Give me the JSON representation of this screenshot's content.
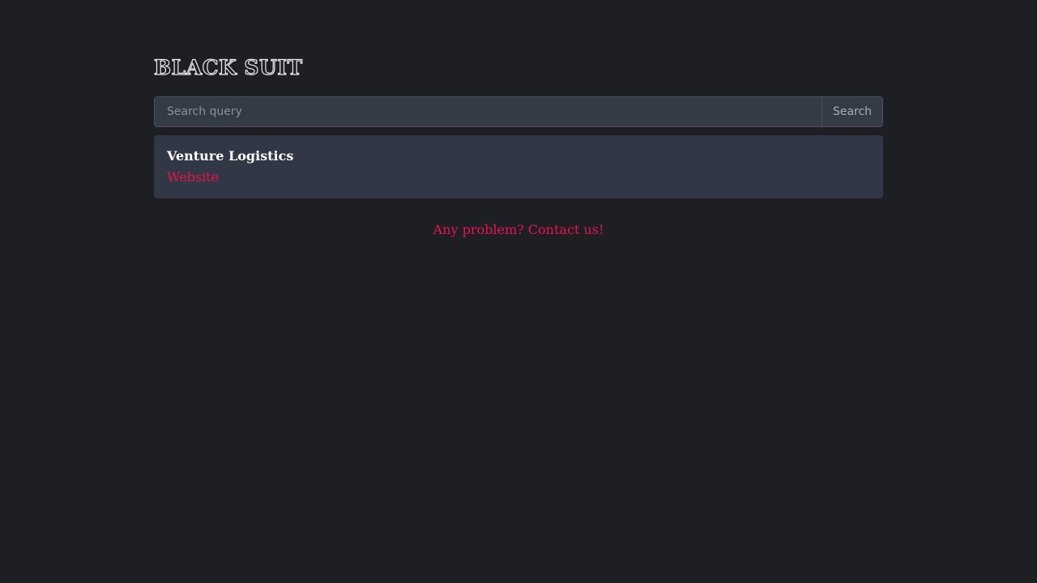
{
  "header": {
    "logo_text": "BLACK SUIT"
  },
  "search": {
    "placeholder": "Search query",
    "value": "",
    "button_label": "Search"
  },
  "results": [
    {
      "title": "Venture Logistics",
      "link_label": "Website"
    }
  ],
  "footer": {
    "contact_label": "Any problem? Contact us!"
  },
  "colors": {
    "background": "#1e1f23",
    "card": "#313745",
    "accent": "#e8134f",
    "input": "#343a46"
  }
}
